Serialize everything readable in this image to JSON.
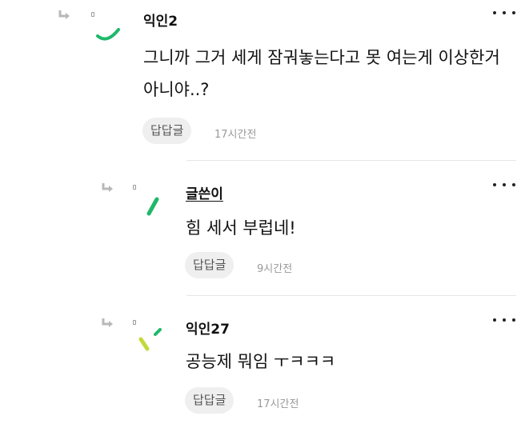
{
  "comments": [
    {
      "nickname": "익인2",
      "text": "그니까 그거 세게 잠궈놓는다고 못 여는게 이상한거 아니야..?",
      "reply_label": "답답글",
      "time": "17시간전"
    },
    {
      "nickname": "글쓴이",
      "text": "힘 세서 부럽네!",
      "reply_label": "답답글",
      "time": "9시간전"
    },
    {
      "nickname": "익인27",
      "text": "공능제 뭐임 ㅜㅋㅋㅋ",
      "reply_label": "답답글",
      "time": "17시간전"
    }
  ],
  "icons": {
    "reply": "reply-arrow-icon",
    "more": "more-options-icon"
  },
  "colors": {
    "avatar_green": "#1fb86a",
    "avatar_lime": "#c2d93a",
    "chip_bg": "#efefef",
    "time_gray": "#999999"
  }
}
